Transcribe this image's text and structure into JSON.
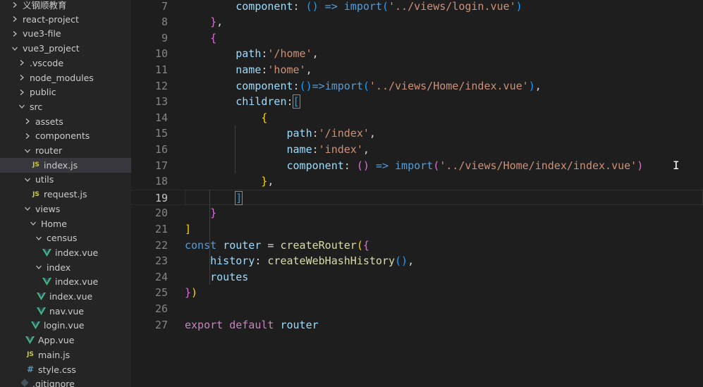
{
  "explorer": {
    "items": [
      {
        "label": "义钢顺教育",
        "type": "folder",
        "state": "closed",
        "depth": 1
      },
      {
        "label": "react-project",
        "type": "folder",
        "state": "closed",
        "depth": 1
      },
      {
        "label": "vue3-file",
        "type": "folder",
        "state": "closed",
        "depth": 1
      },
      {
        "label": "vue3_project",
        "type": "folder",
        "state": "open",
        "depth": 1
      },
      {
        "label": ".vscode",
        "type": "folder",
        "state": "closed",
        "depth": 2
      },
      {
        "label": "node_modules",
        "type": "folder",
        "state": "closed",
        "depth": 2
      },
      {
        "label": "public",
        "type": "folder",
        "state": "closed",
        "depth": 2
      },
      {
        "label": "src",
        "type": "folder",
        "state": "open",
        "depth": 2
      },
      {
        "label": "assets",
        "type": "folder",
        "state": "closed",
        "depth": 3
      },
      {
        "label": "components",
        "type": "folder",
        "state": "closed",
        "depth": 3
      },
      {
        "label": "router",
        "type": "folder",
        "state": "open",
        "depth": 3
      },
      {
        "label": "index.js",
        "type": "js",
        "depth": 4,
        "selected": true
      },
      {
        "label": "utils",
        "type": "folder",
        "state": "open",
        "depth": 3
      },
      {
        "label": "request.js",
        "type": "js",
        "depth": 4
      },
      {
        "label": "views",
        "type": "folder",
        "state": "open",
        "depth": 3
      },
      {
        "label": "Home",
        "type": "folder",
        "state": "open",
        "depth": 4
      },
      {
        "label": "census",
        "type": "folder",
        "state": "open",
        "depth": 5
      },
      {
        "label": "index.vue",
        "type": "vue",
        "depth": 6
      },
      {
        "label": "index",
        "type": "folder",
        "state": "open",
        "depth": 5
      },
      {
        "label": "index.vue",
        "type": "vue",
        "depth": 6
      },
      {
        "label": "index.vue",
        "type": "vue",
        "depth": 5
      },
      {
        "label": "nav.vue",
        "type": "vue",
        "depth": 5
      },
      {
        "label": "login.vue",
        "type": "vue",
        "depth": 4
      },
      {
        "label": "App.vue",
        "type": "vue",
        "depth": 3
      },
      {
        "label": "main.js",
        "type": "js",
        "depth": 3
      },
      {
        "label": "style.css",
        "type": "css",
        "depth": 3
      },
      {
        "label": ".gitignore",
        "type": "git",
        "depth": 2
      }
    ],
    "icons": {
      "js": "JS",
      "css": "#",
      "folder_closed": "chevron-right-icon",
      "folder_open": "chevron-down-icon",
      "vue": "vue-icon",
      "git": "git-icon"
    },
    "colors": {
      "vue": "#41b883",
      "js": "#cbcb41",
      "css": "#519aba"
    }
  },
  "editor": {
    "active_line": "19",
    "lines": [
      {
        "n": "7",
        "tokens": [
          {
            "t": "        component",
            "c": "prop"
          },
          {
            "t": ": ",
            "c": "op"
          },
          {
            "t": "()",
            "c": "p3"
          },
          {
            "t": " ",
            "c": "op"
          },
          {
            "t": "=>",
            "c": "kw"
          },
          {
            "t": " ",
            "c": "op"
          },
          {
            "t": "import",
            "c": "kw"
          },
          {
            "t": "(",
            "c": "p3"
          },
          {
            "t": "'../views/login.vue'",
            "c": "str"
          },
          {
            "t": ")",
            "c": "p3"
          }
        ]
      },
      {
        "n": "8",
        "tokens": [
          {
            "t": "    ",
            "c": "op"
          },
          {
            "t": "}",
            "c": "p2"
          },
          {
            "t": ",",
            "c": "op"
          }
        ]
      },
      {
        "n": "9",
        "tokens": [
          {
            "t": "    ",
            "c": "op"
          },
          {
            "t": "{",
            "c": "p2"
          }
        ]
      },
      {
        "n": "10",
        "tokens": [
          {
            "t": "        path",
            "c": "prop"
          },
          {
            "t": ":",
            "c": "op"
          },
          {
            "t": "'/home'",
            "c": "str"
          },
          {
            "t": ",",
            "c": "op"
          }
        ]
      },
      {
        "n": "11",
        "tokens": [
          {
            "t": "        name",
            "c": "prop"
          },
          {
            "t": ":",
            "c": "op"
          },
          {
            "t": "'home'",
            "c": "str"
          },
          {
            "t": ",",
            "c": "op"
          }
        ]
      },
      {
        "n": "12",
        "tokens": [
          {
            "t": "        component",
            "c": "prop"
          },
          {
            "t": ":",
            "c": "op"
          },
          {
            "t": "()",
            "c": "p3"
          },
          {
            "t": "=>",
            "c": "kw"
          },
          {
            "t": "import",
            "c": "kw"
          },
          {
            "t": "(",
            "c": "p3"
          },
          {
            "t": "'../views/Home/index.vue'",
            "c": "str"
          },
          {
            "t": ")",
            "c": "p3"
          },
          {
            "t": ",",
            "c": "op"
          }
        ]
      },
      {
        "n": "13",
        "tokens": [
          {
            "t": "        children",
            "c": "prop"
          },
          {
            "t": ":",
            "c": "op"
          },
          {
            "t": "[",
            "c": "p3"
          }
        ]
      },
      {
        "n": "14",
        "tokens": [
          {
            "t": "            ",
            "c": "op"
          },
          {
            "t": "{",
            "c": "p1"
          }
        ]
      },
      {
        "n": "15",
        "tokens": [
          {
            "t": "                path",
            "c": "prop"
          },
          {
            "t": ":",
            "c": "op"
          },
          {
            "t": "'/index'",
            "c": "str"
          },
          {
            "t": ",",
            "c": "op"
          }
        ]
      },
      {
        "n": "16",
        "tokens": [
          {
            "t": "                name",
            "c": "prop"
          },
          {
            "t": ":",
            "c": "op"
          },
          {
            "t": "'index'",
            "c": "str"
          },
          {
            "t": ",",
            "c": "op"
          }
        ]
      },
      {
        "n": "17",
        "tokens": [
          {
            "t": "                component",
            "c": "prop"
          },
          {
            "t": ": ",
            "c": "op"
          },
          {
            "t": "()",
            "c": "p2"
          },
          {
            "t": " ",
            "c": "op"
          },
          {
            "t": "=>",
            "c": "kw"
          },
          {
            "t": " ",
            "c": "op"
          },
          {
            "t": "import",
            "c": "kw"
          },
          {
            "t": "(",
            "c": "p2"
          },
          {
            "t": "'../views/Home/index/index.vue'",
            "c": "str"
          },
          {
            "t": ")",
            "c": "p2"
          }
        ]
      },
      {
        "n": "18",
        "tokens": [
          {
            "t": "            ",
            "c": "op"
          },
          {
            "t": "}",
            "c": "p1"
          },
          {
            "t": ",",
            "c": "op"
          }
        ]
      },
      {
        "n": "19",
        "tokens": [
          {
            "t": "        ",
            "c": "op"
          },
          {
            "t": "]",
            "c": "p3"
          }
        ]
      },
      {
        "n": "20",
        "tokens": [
          {
            "t": "    ",
            "c": "op"
          },
          {
            "t": "}",
            "c": "p2"
          }
        ]
      },
      {
        "n": "21",
        "tokens": [
          {
            "t": "]",
            "c": "p1"
          }
        ]
      },
      {
        "n": "22",
        "tokens": [
          {
            "t": "const",
            "c": "kw"
          },
          {
            "t": " ",
            "c": "op"
          },
          {
            "t": "router",
            "c": "prop"
          },
          {
            "t": " = ",
            "c": "op"
          },
          {
            "t": "createRouter",
            "c": "fn"
          },
          {
            "t": "(",
            "c": "p1"
          },
          {
            "t": "{",
            "c": "p2"
          }
        ]
      },
      {
        "n": "23",
        "tokens": [
          {
            "t": "    history",
            "c": "prop"
          },
          {
            "t": ": ",
            "c": "op"
          },
          {
            "t": "createWebHashHistory",
            "c": "fn"
          },
          {
            "t": "()",
            "c": "p3"
          },
          {
            "t": ",",
            "c": "op"
          }
        ]
      },
      {
        "n": "24",
        "tokens": [
          {
            "t": "    routes",
            "c": "prop"
          }
        ]
      },
      {
        "n": "25",
        "tokens": [
          {
            "t": "}",
            "c": "p2"
          },
          {
            "t": ")",
            "c": "p1"
          }
        ]
      },
      {
        "n": "26",
        "tokens": []
      },
      {
        "n": "27",
        "tokens": [
          {
            "t": "export",
            "c": "ctrl"
          },
          {
            "t": " ",
            "c": "op"
          },
          {
            "t": "default",
            "c": "ctrl"
          },
          {
            "t": " ",
            "c": "op"
          },
          {
            "t": "router",
            "c": "prop"
          }
        ]
      }
    ],
    "cursor_icon": "text-cursor-icon",
    "colors": {
      "background": "#1e1e1e",
      "keyword": "#569cd6",
      "property": "#9cdcfe",
      "string": "#ce9178",
      "function": "#dcdcaa",
      "bracket1": "#ffd700",
      "bracket2": "#da70d6",
      "bracket3": "#179fff"
    }
  }
}
